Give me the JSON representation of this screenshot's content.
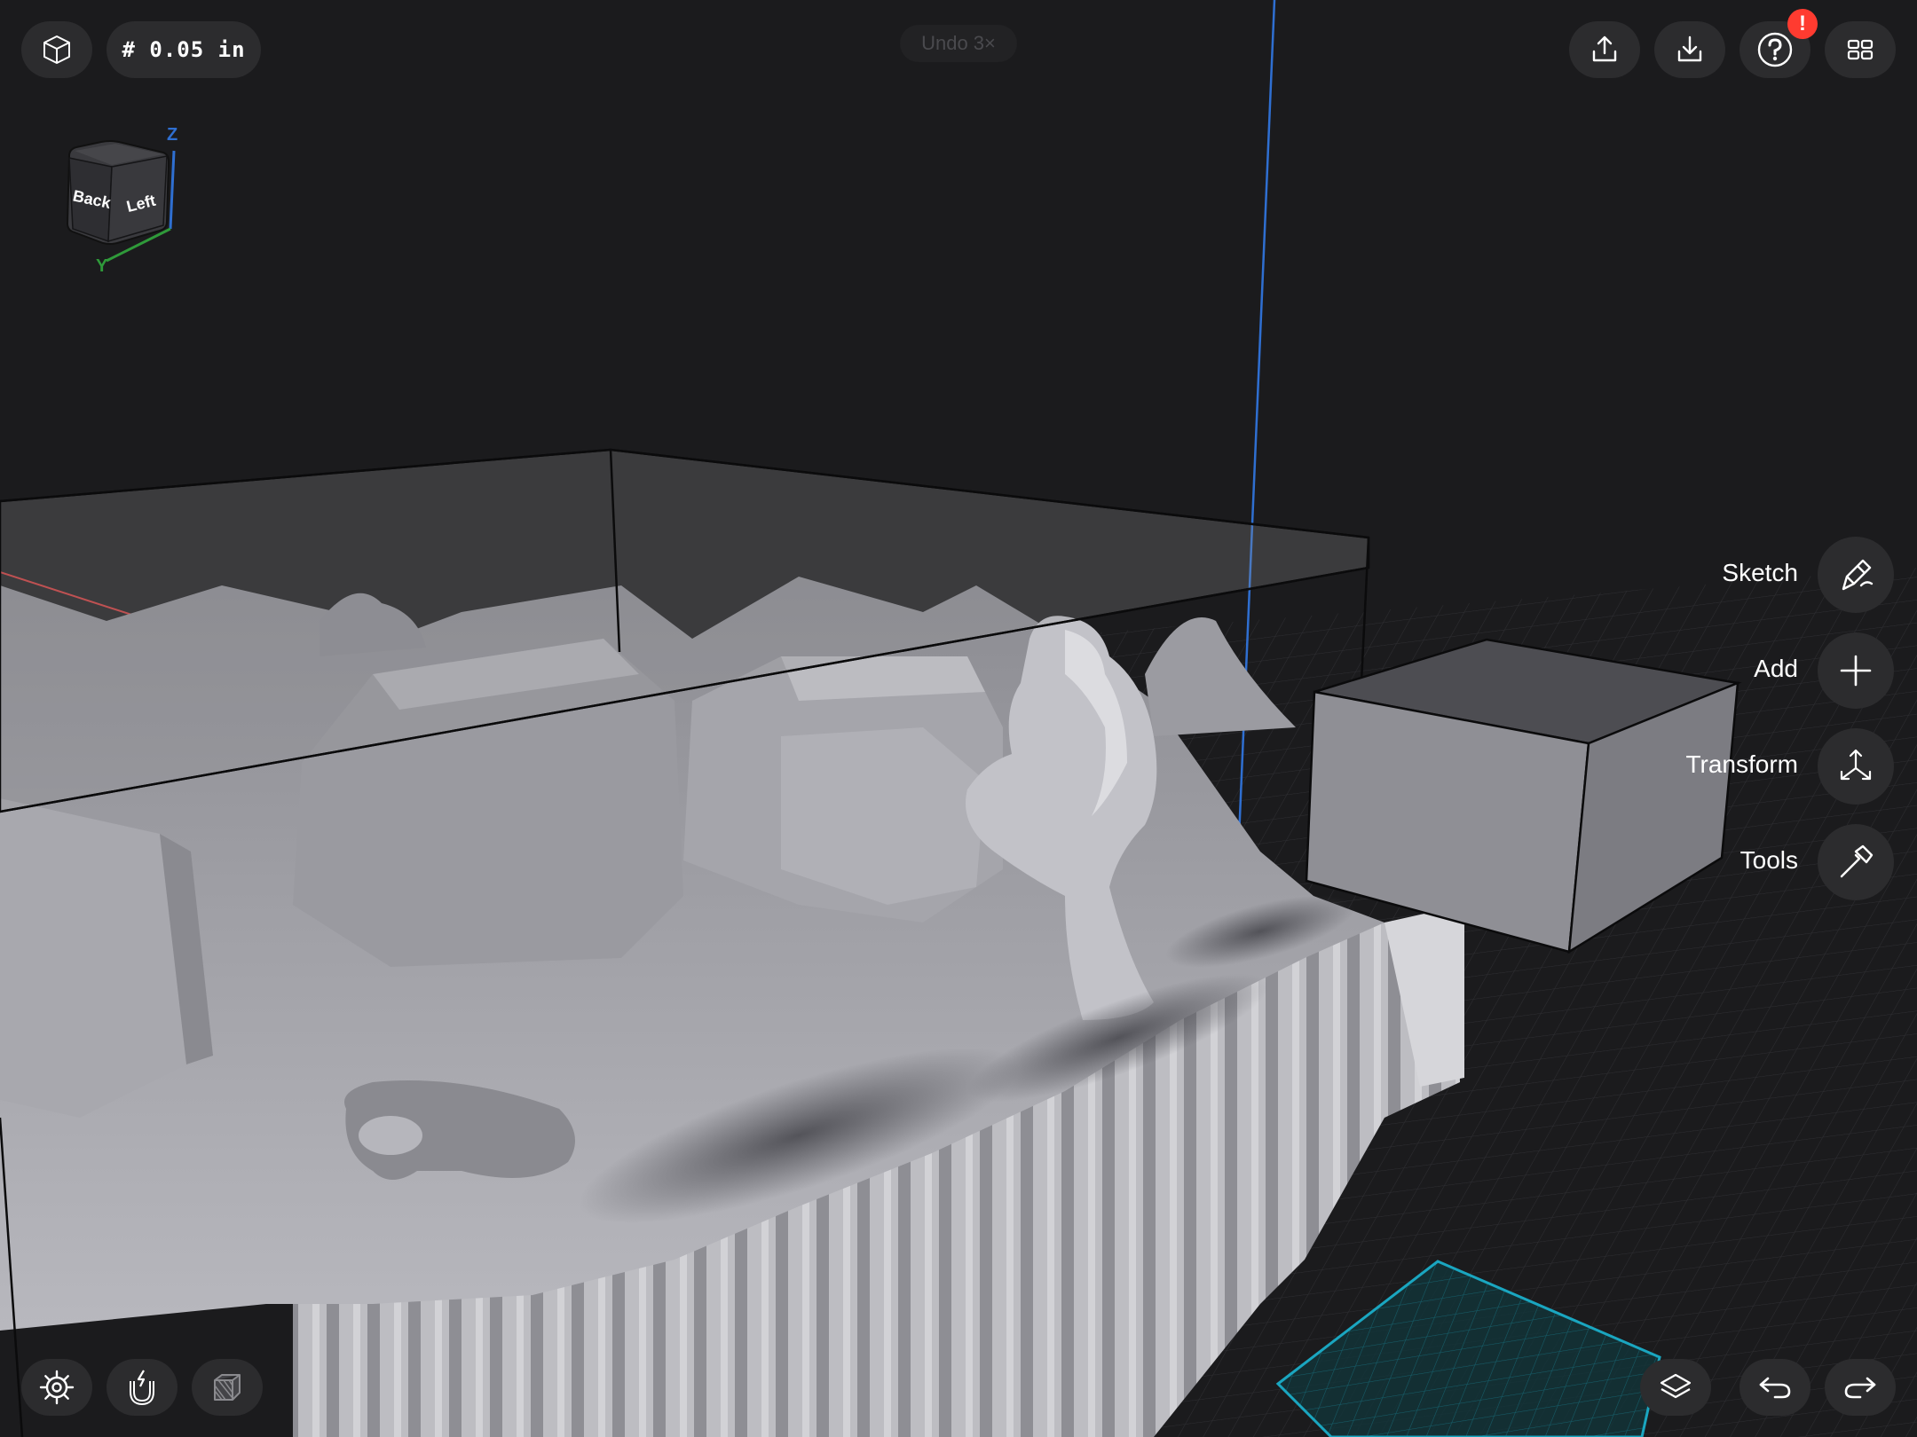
{
  "toolbar": {
    "grid_size": "# 0.05 in",
    "undo_label": "Undo 3×",
    "alert_badge": "!"
  },
  "nav_cube": {
    "face_back": "Back",
    "face_left": "Left",
    "axis_z": "Z",
    "axis_y": "Y"
  },
  "side_menu": {
    "sketch": "Sketch",
    "add": "Add",
    "transform": "Transform",
    "tools": "Tools"
  },
  "icons": {
    "top_left": "cube-icon",
    "upload": "upload-icon",
    "download": "download-icon",
    "help": "help-icon",
    "grid_menu": "grid-menu-icon",
    "settings": "gear-icon",
    "snap": "magnet-icon",
    "material": "layers-box-icon",
    "layers": "layers-icon",
    "undo": "undo-arrow-icon",
    "redo": "redo-arrow-icon"
  },
  "colors": {
    "background": "#1b1b1d",
    "button": "#2c2c2e",
    "alert": "#ff3b30",
    "axis_x": "#d23a3a",
    "axis_z": "#2f6fd1",
    "axis_y": "#2f9a3a",
    "workplane": "#1aa6c0"
  }
}
